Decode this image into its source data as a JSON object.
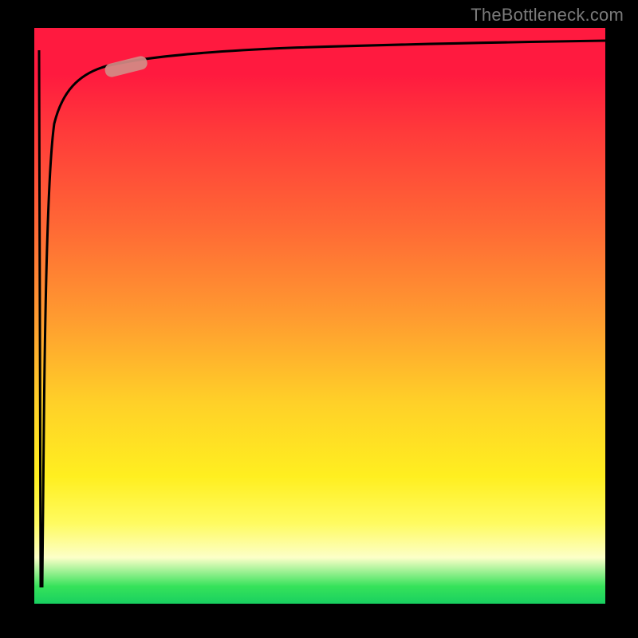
{
  "attribution": "TheBottleneck.com",
  "colors": {
    "black": "#000000",
    "gradient_top": "#ff1a3f",
    "gradient_mid_orange": "#ff9a30",
    "gradient_yellow": "#ffef20",
    "gradient_green": "#18d060",
    "curve_stroke": "#000000",
    "dash_fill": "#d28b86",
    "attribution_text": "#7a7a7a"
  },
  "chart_data": {
    "type": "line",
    "title": "",
    "xlabel": "",
    "ylabel": "",
    "xlim": [
      0,
      100
    ],
    "ylim": [
      0,
      100
    ],
    "x": [
      0,
      0.3,
      0.5,
      0.8,
      1,
      1.5,
      2,
      2.5,
      3,
      4,
      5,
      7,
      10,
      15,
      20,
      30,
      40,
      55,
      70,
      85,
      100
    ],
    "values": [
      96,
      0,
      10,
      40,
      60,
      75,
      82,
      85,
      87,
      89,
      90,
      91.5,
      93,
      94,
      94.8,
      95.6,
      96,
      96.5,
      96.8,
      97,
      97.2
    ],
    "marker": {
      "x_range": [
        10,
        17
      ],
      "y_range": [
        92,
        94
      ],
      "shape": "pill"
    }
  }
}
